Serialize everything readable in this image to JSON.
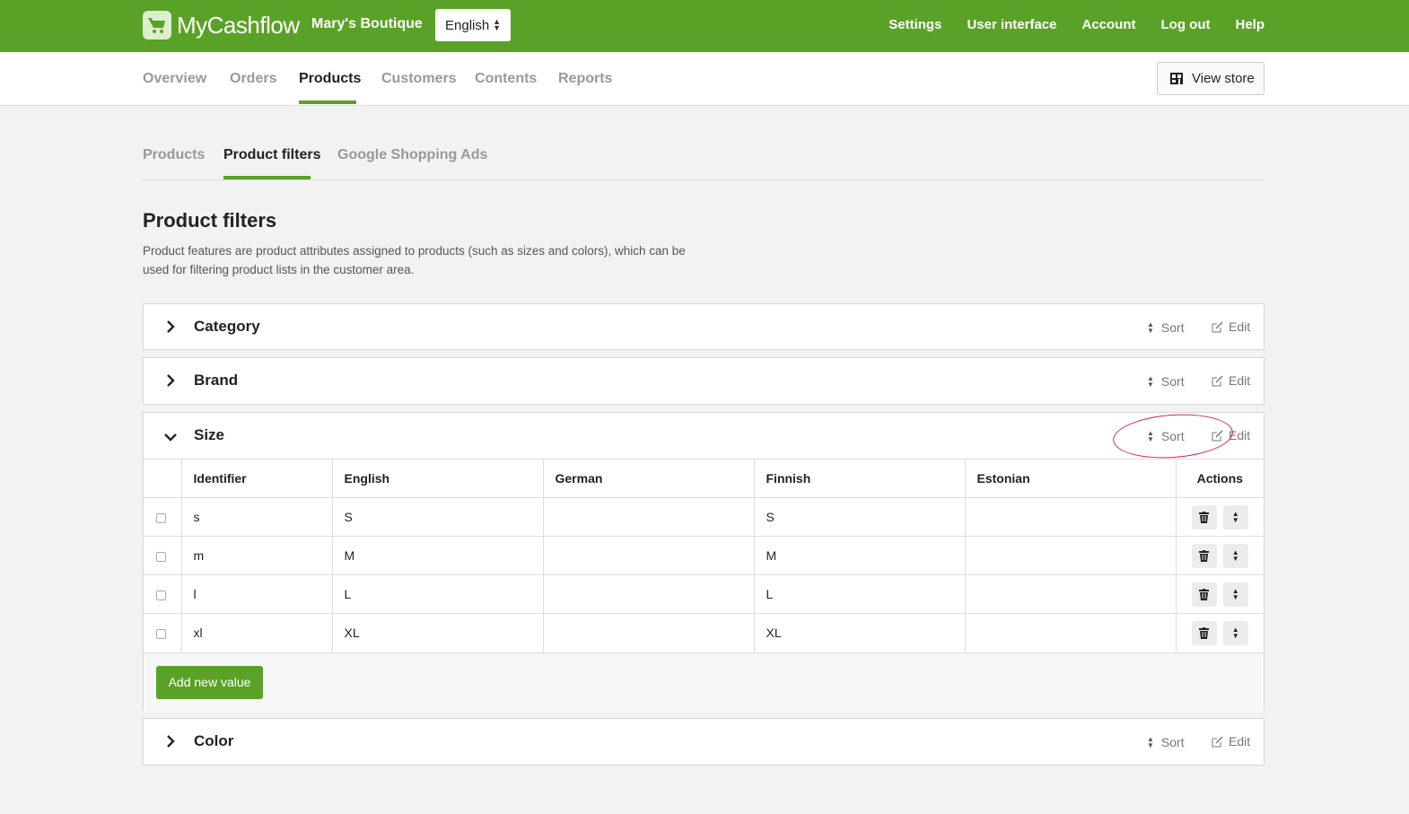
{
  "brand": {
    "name": "MyCashflow"
  },
  "header": {
    "shop_name": "Mary's Boutique",
    "language": "English",
    "links": [
      "Settings",
      "User interface",
      "Account",
      "Log out",
      "Help"
    ]
  },
  "mainnav": {
    "items": [
      "Overview",
      "Orders",
      "Products",
      "Customers",
      "Contents",
      "Reports"
    ],
    "active": "Products",
    "view_store": "View store"
  },
  "subnav": {
    "items": [
      "Products",
      "Product filters",
      "Google Shopping Ads"
    ],
    "active": "Product filters"
  },
  "page": {
    "title": "Product filters",
    "description": "Product features are product attributes assigned to products (such as sizes and colors), which can be used for filtering product lists in the customer area."
  },
  "panel_actions": {
    "sort": "Sort",
    "edit": "Edit"
  },
  "filters": [
    {
      "name": "Category",
      "expanded": false
    },
    {
      "name": "Brand",
      "expanded": false
    },
    {
      "name": "Size",
      "expanded": true
    },
    {
      "name": "Color",
      "expanded": false
    }
  ],
  "size_table": {
    "columns": [
      "Identifier",
      "English",
      "German",
      "Finnish",
      "Estonian",
      "Actions"
    ],
    "rows": [
      {
        "identifier": "s",
        "english": "S",
        "german": "",
        "finnish": "S",
        "estonian": ""
      },
      {
        "identifier": "m",
        "english": "M",
        "german": "",
        "finnish": "M",
        "estonian": ""
      },
      {
        "identifier": "l",
        "english": "L",
        "german": "",
        "finnish": "L",
        "estonian": ""
      },
      {
        "identifier": "xl",
        "english": "XL",
        "german": "",
        "finnish": "XL",
        "estonian": ""
      }
    ],
    "add_button": "Add new value"
  },
  "colors": {
    "brand_green": "#5aa227",
    "annotation": "#d6215b"
  }
}
